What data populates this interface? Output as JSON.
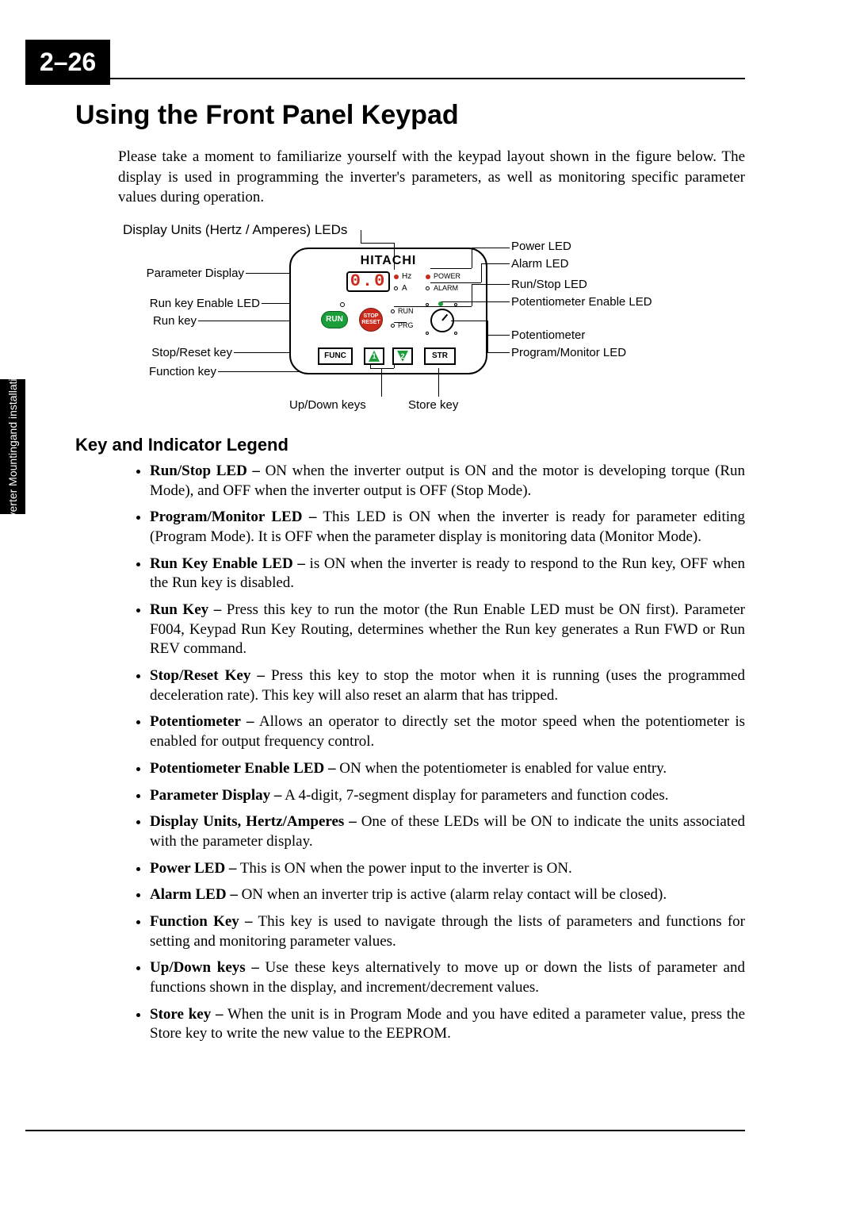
{
  "page_number": "2–26",
  "side_tab": "Inverter Mountingand\ninstallation",
  "section_title": "Using the Front Panel Keypad",
  "intro_paragraph": "Please take a moment to familiarize yourself with the keypad layout shown in the figure below. The display is used in programming the inverter's parameters, as well as monitoring specific parameter values during operation.",
  "diagram": {
    "title": "Display Units (Hertz / Amperes) LEDs",
    "brand": "HITACHI",
    "display_value": "0.0",
    "hz_label": "Hz",
    "a_label": "A",
    "power_label": "POWER",
    "alarm_label": "ALARM",
    "run_key_label": "RUN",
    "stop_key_label": "STOP\nRESET",
    "run_led_label": "RUN",
    "prg_led_label": "PRG",
    "func_key_label": "FUNC",
    "up_key_num": "1",
    "down_key_num": "2",
    "str_key_label": "STR",
    "callouts_left": {
      "parameter_display": "Parameter Display",
      "run_key_enable_led": "Run key Enable LED",
      "run_key": "Run key",
      "stop_reset_key": "Stop/Reset key",
      "function_key": "Function key"
    },
    "callouts_right": {
      "power_led": "Power LED",
      "alarm_led": "Alarm LED",
      "run_stop_led": "Run/Stop LED",
      "pot_enable_led": "Potentiometer Enable LED",
      "potentiometer": "Potentiometer",
      "prg_monitor_led": "Program/Monitor LED"
    },
    "callouts_bottom": {
      "up_down_keys": "Up/Down keys",
      "store_key": "Store key"
    }
  },
  "subsection_title": "Key and Indicator Legend",
  "legend": [
    {
      "term": "Run/Stop LED –",
      "desc": " ON when the inverter output is ON and the motor is developing torque (Run Mode), and OFF when the inverter output is OFF (Stop Mode)."
    },
    {
      "term": "Program/Monitor LED –",
      "desc": " This LED is ON when the inverter is ready for parameter editing (Program Mode). It is OFF when the parameter display is monitoring data (Monitor Mode)."
    },
    {
      "term": "Run Key Enable LED –",
      "desc": " is ON when the inverter is ready to respond to the Run key, OFF when the Run key is disabled."
    },
    {
      "term": "Run Key –",
      "desc": " Press this key to run the motor (the Run Enable LED must be ON first). Parameter F004, Keypad Run Key Routing, determines whether the Run key generates a Run FWD or Run REV command."
    },
    {
      "term": "Stop/Reset Key –",
      "desc": " Press this key to stop the motor when it is running (uses the programmed deceleration rate). This key will also reset an alarm that has tripped."
    },
    {
      "term": "Potentiometer  –",
      "desc": " Allows an operator to directly set the motor speed when the potentiometer is enabled for output frequency control."
    },
    {
      "term": "Potentiometer Enable LED –",
      "desc": " ON when the potentiometer is enabled for value entry."
    },
    {
      "term": "Parameter Display –",
      "desc": " A 4-digit, 7-segment display for parameters and function codes."
    },
    {
      "term": "Display Units, Hertz/Amperes –",
      "desc": " One of these LEDs will be ON to indicate the units associated with the parameter display."
    },
    {
      "term": "Power LED –",
      "desc": " This is ON when the power input to the inverter is ON."
    },
    {
      "term": "Alarm LED –",
      "desc": " ON when an inverter trip is active (alarm relay contact will be closed)."
    },
    {
      "term": "Function Key –",
      "desc": " This key is used to navigate through the lists of parameters and functions for setting and monitoring parameter values."
    },
    {
      "term": "Up/Down keys –",
      "desc": " Use these keys alternatively to move up or down the lists of parameter and functions shown in the display, and increment/decrement values."
    },
    {
      "term": "Store key –",
      "desc": " When the unit is in Program Mode and you have edited a parameter value, press the Store key to write the new value to the EEPROM."
    }
  ]
}
